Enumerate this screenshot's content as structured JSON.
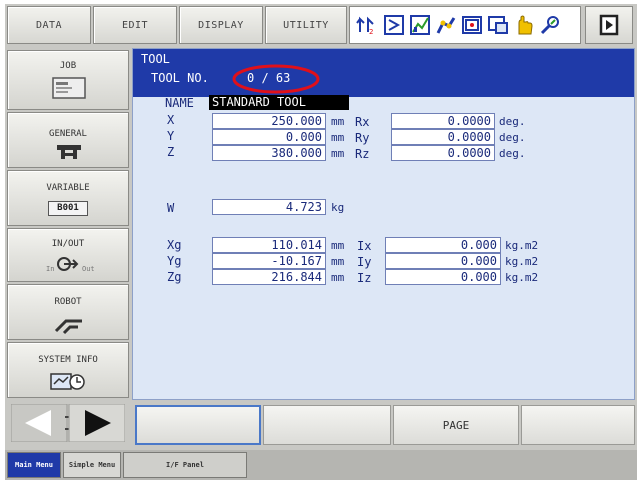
{
  "menubar": {
    "data": "DATA",
    "edit": "EDIT",
    "display": "DISPLAY",
    "utility": "UTILITY"
  },
  "sidebar": {
    "job": "JOB",
    "general": "GENERAL",
    "variable": "VARIABLE",
    "variable_value": "B001",
    "inout": "IN/OUT",
    "in_label": "In",
    "out_label": "Out",
    "robot": "ROBOT",
    "system_info": "SYSTEM INFO"
  },
  "tool": {
    "header": "TOOL",
    "tool_no_label": "TOOL NO.",
    "tool_no_value": "0 / 63",
    "name_label": "NAME",
    "name_value": "STANDARD TOOL",
    "x_label": "X",
    "x_value": "250.000",
    "y_label": "Y",
    "y_value": "0.000",
    "z_label": "Z",
    "z_value": "380.000",
    "rx_label": "Rx",
    "rx_value": "0.0000",
    "ry_label": "Ry",
    "ry_value": "0.0000",
    "rz_label": "Rz",
    "rz_value": "0.0000",
    "w_label": "W",
    "w_value": "4.723",
    "xg_label": "Xg",
    "xg_value": "110.014",
    "yg_label": "Yg",
    "yg_value": "-10.167",
    "zg_label": "Zg",
    "zg_value": "216.844",
    "ix_label": "Ix",
    "ix_value": "0.000",
    "iy_label": "Iy",
    "iy_value": "0.000",
    "iz_label": "Iz",
    "iz_value": "0.000",
    "unit_mm": "mm",
    "unit_deg": "deg.",
    "unit_kg": "kg",
    "unit_kgm2": "kg.m2"
  },
  "pagebar": {
    "page": "PAGE"
  },
  "tabs": {
    "main_menu": "Main Menu",
    "simple_menu": "Simple Menu",
    "if_panel": "I/F Panel"
  },
  "colors": {
    "title_blue": "#1f3aa8",
    "content_bg": "#dde7f6",
    "highlight_red": "#e0101a",
    "active_tab": "#1f3aa8"
  }
}
